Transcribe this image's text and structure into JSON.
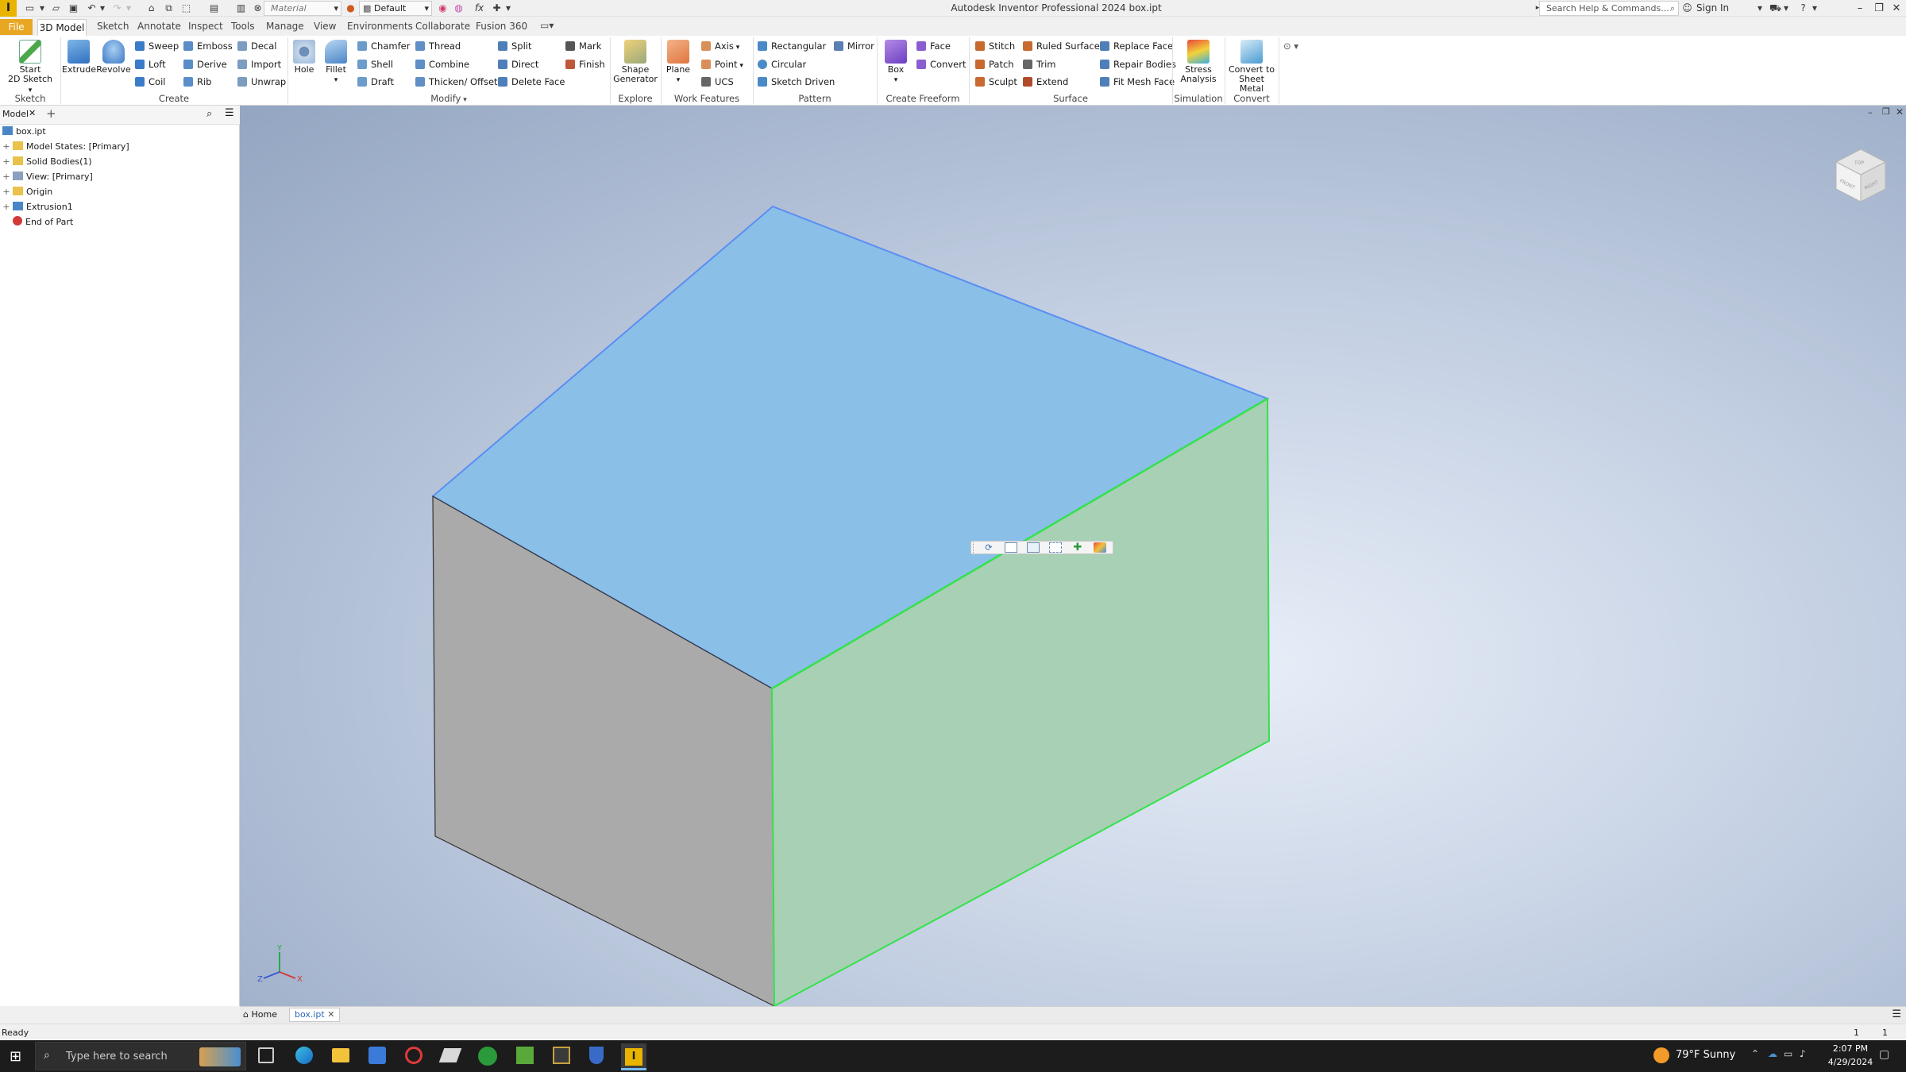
{
  "window": {
    "title": "Autodesk Inventor Professional 2024   box.ipt",
    "material_value": "Material",
    "appearance_value": "Default",
    "search_placeholder": "Search Help & Commands...",
    "sign_in": "Sign In"
  },
  "tabs": [
    {
      "label": "File"
    },
    {
      "label": "3D Model"
    },
    {
      "label": "Sketch"
    },
    {
      "label": "Annotate"
    },
    {
      "label": "Inspect"
    },
    {
      "label": "Tools"
    },
    {
      "label": "Manage"
    },
    {
      "label": "View"
    },
    {
      "label": "Environments"
    },
    {
      "label": "Collaborate"
    },
    {
      "label": "Fusion 360"
    }
  ],
  "ribbon": {
    "sketch": {
      "start": "Start",
      "start2": "2D Sketch",
      "group": "Sketch"
    },
    "create": {
      "extrude": "Extrude",
      "revolve": "Revolve",
      "sweep": "Sweep",
      "loft": "Loft",
      "coil": "Coil",
      "emboss": "Emboss",
      "derive": "Derive",
      "rib": "Rib",
      "decal": "Decal",
      "import": "Import",
      "unwrap": "Unwrap",
      "group": "Create"
    },
    "modify": {
      "hole": "Hole",
      "fillet": "Fillet",
      "chamfer": "Chamfer",
      "shell": "Shell",
      "draft": "Draft",
      "thread": "Thread",
      "combine": "Combine",
      "thicken": "Thicken/ Offset",
      "split": "Split",
      "direct": "Direct",
      "delete_face": "Delete Face",
      "mark": "Mark",
      "finish": "Finish",
      "group": "Modify"
    },
    "explore": {
      "shape": "Shape",
      "generator": "Generator",
      "group": "Explore"
    },
    "work": {
      "plane": "Plane",
      "axis": "Axis",
      "point": "Point",
      "ucs": "UCS",
      "group": "Work Features"
    },
    "pattern": {
      "rect": "Rectangular",
      "circ": "Circular",
      "sketch_driven": "Sketch Driven",
      "mirror": "Mirror",
      "group": "Pattern"
    },
    "freeform": {
      "box": "Box",
      "face": "Face",
      "convert": "Convert",
      "group": "Create Freeform"
    },
    "surface": {
      "stitch": "Stitch",
      "patch": "Patch",
      "sculpt": "Sculpt",
      "ruled": "Ruled Surface",
      "trim": "Trim",
      "extend": "Extend",
      "replace": "Replace Face",
      "repair": "Repair Bodies",
      "fitmesh": "Fit Mesh Face",
      "group": "Surface"
    },
    "simulation": {
      "stress": "Stress",
      "analysis": "Analysis",
      "group": "Simulation"
    },
    "convert": {
      "to": "Convert to",
      "sheet": "Sheet Metal",
      "group": "Convert"
    }
  },
  "browser": {
    "tab": "Model",
    "items": [
      {
        "label": "box.ipt"
      },
      {
        "label": "Model States: [Primary]"
      },
      {
        "label": "Solid Bodies(1)"
      },
      {
        "label": "View: [Primary]"
      },
      {
        "label": "Origin"
      },
      {
        "label": "Extrusion1"
      },
      {
        "label": "End of Part"
      }
    ]
  },
  "viewcube": {
    "top": "TOP",
    "front": "FRONT",
    "right": "RIGHT"
  },
  "axes": {
    "x": "X",
    "y": "Y",
    "z": "Z"
  },
  "doc_tabs": [
    {
      "label": "Home"
    },
    {
      "label": "box.ipt"
    }
  ],
  "status": {
    "text": "Ready",
    "count1": "1",
    "count2": "1"
  },
  "taskbar": {
    "search_placeholder": "Type here to search",
    "weather": "79°F  Sunny",
    "time": "2:07 PM",
    "date": "4/29/2024"
  },
  "colors": {
    "top_face": "#8abfe8",
    "right_face": "#a8d0b4",
    "left_face": "#aaaaaa",
    "highlight_green": "#34e24c",
    "highlight_blue": "#5b8ef2",
    "file_tab": "#e8a623"
  }
}
